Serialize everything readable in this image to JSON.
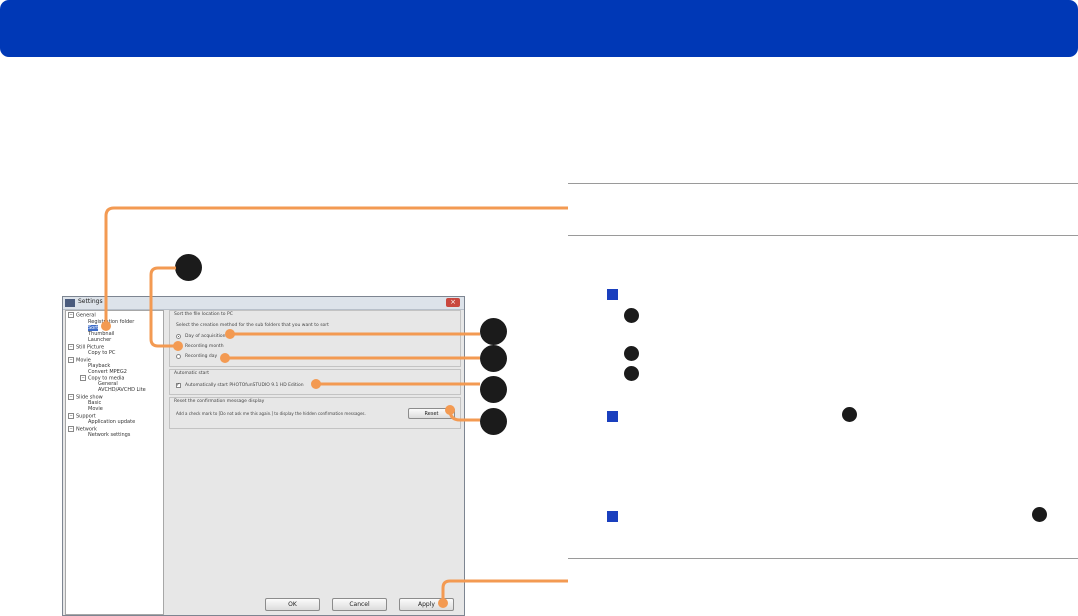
{
  "colors": {
    "header_blue": "#0038b6",
    "callout_orange": "#f39a52",
    "bullet_blue": "#1a3fbe"
  },
  "window": {
    "title": "Settings",
    "close_glyph": "×",
    "tree": [
      {
        "label": "General",
        "expander": "−"
      },
      {
        "label": "Registration folder"
      },
      {
        "label": "Sort",
        "selected": true
      },
      {
        "label": "Thumbnail"
      },
      {
        "label": "Launcher"
      },
      {
        "label": "Still Picture",
        "expander": "−"
      },
      {
        "label": "Copy to PC"
      },
      {
        "label": "Movie",
        "expander": "−"
      },
      {
        "label": "Playback"
      },
      {
        "label": "Convert MPEG2"
      },
      {
        "label": "Copy to media",
        "expander": "−"
      },
      {
        "label": "General"
      },
      {
        "label": "AVCHD/AVCHD Lite"
      },
      {
        "label": "Slide show",
        "expander": "−"
      },
      {
        "label": "Basic"
      },
      {
        "label": "Movie"
      },
      {
        "label": "Support",
        "expander": "−"
      },
      {
        "label": "Application update"
      },
      {
        "label": "Network",
        "expander": "−"
      },
      {
        "label": "Network settings"
      }
    ],
    "sort_group": {
      "title": "Sort the file location to PC",
      "description": "Select the creation method for the sub folders that you want to sort",
      "options": [
        "Day of acquisition",
        "Recording month",
        "Recording day"
      ],
      "selected_index": 0
    },
    "autostart_group": {
      "title": "Automatic start",
      "checkbox_label": "Automatically start PHOTOfunSTUDIO 9.1 HD Edition",
      "checkbox_glyph": "✓",
      "checked": true
    },
    "reset_group": {
      "title": "Reset the confirmation message display",
      "description": "Add a check mark to [Do not ask me this again.] to display the hidden confirmation messages.",
      "button": "Reset"
    },
    "buttons": {
      "ok": "OK",
      "cancel": "Cancel",
      "apply": "Apply"
    }
  }
}
